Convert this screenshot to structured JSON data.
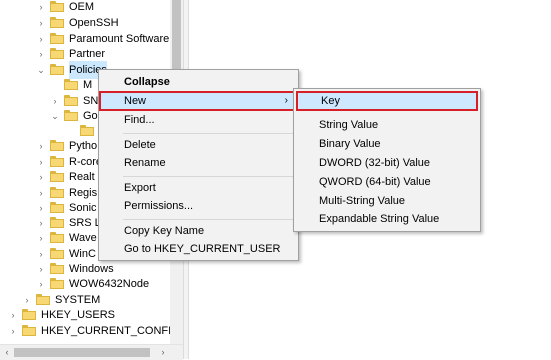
{
  "tree": {
    "items": [
      {
        "label": "OEM",
        "expander": "›"
      },
      {
        "label": "OpenSSH",
        "expander": "›"
      },
      {
        "label": "Paramount Software (",
        "expander": "›"
      },
      {
        "label": "Partner",
        "expander": "›"
      },
      {
        "label": "Policies",
        "expander": "⌄"
      },
      {
        "label": "M",
        "expander": ""
      },
      {
        "label": "SN",
        "expander": "›"
      },
      {
        "label": "Go",
        "expander": "⌄"
      },
      {
        "label": "",
        "expander": ""
      },
      {
        "label": "Pytho",
        "expander": "›"
      },
      {
        "label": "R-core",
        "expander": "›"
      },
      {
        "label": "Realt",
        "expander": "›"
      },
      {
        "label": "Regis",
        "expander": "›"
      },
      {
        "label": "Sonic",
        "expander": "›"
      },
      {
        "label": "SRS L",
        "expander": "›"
      },
      {
        "label": "Wave",
        "expander": "›"
      },
      {
        "label": "WinC",
        "expander": "›"
      },
      {
        "label": "Windows",
        "expander": "›"
      },
      {
        "label": "WOW6432Node",
        "expander": "›"
      },
      {
        "label": "SYSTEM",
        "expander": "›"
      },
      {
        "label": "HKEY_USERS",
        "expander": "›"
      },
      {
        "label": "HKEY_CURRENT_CONFIG",
        "expander": "›"
      }
    ]
  },
  "context_menu": {
    "collapse": "Collapse",
    "new": "New",
    "new_arrow": "›",
    "find": "Find...",
    "delete": "Delete",
    "rename": "Rename",
    "export": "Export",
    "permissions": "Permissions...",
    "copy_key_name": "Copy Key Name",
    "goto": "Go to HKEY_CURRENT_USER"
  },
  "submenu": {
    "key": "Key",
    "string_value": "String Value",
    "binary_value": "Binary Value",
    "dword": "DWORD (32-bit) Value",
    "qword": "QWORD (64-bit) Value",
    "multi_string": "Multi-String Value",
    "expandable_string": "Expandable String Value"
  },
  "scroll": {
    "left": "‹",
    "right": "›"
  },
  "colors": {
    "highlight_border": "#d61f26",
    "highlight_fill": "#cde8ff",
    "folder": "#f8d775"
  }
}
